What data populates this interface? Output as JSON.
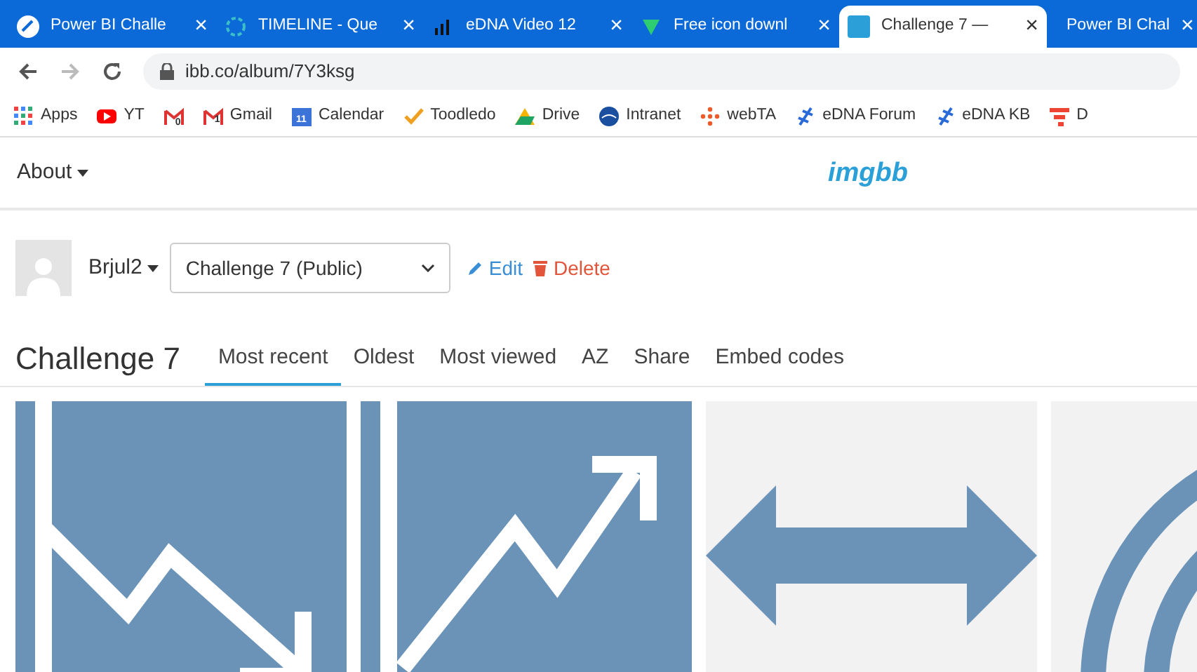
{
  "browser": {
    "tabs": [
      {
        "title": "Power BI Challe",
        "selected": false
      },
      {
        "title": "TIMELINE - Que",
        "selected": false
      },
      {
        "title": "eDNA Video 12",
        "selected": false
      },
      {
        "title": "Free icon downl",
        "selected": false
      },
      {
        "title": "Challenge 7 —",
        "selected": true
      },
      {
        "title": "Power BI Chal",
        "selected": false
      }
    ],
    "tab_close": "×",
    "address": "ibb.co/album/7Y3ksg",
    "bookmarks": [
      {
        "kind": "grid",
        "label": "Apps"
      },
      {
        "kind": "play",
        "label": "YT"
      },
      {
        "kind": "mail",
        "count": "0"
      },
      {
        "kind": "mail",
        "label": "Gmail",
        "count": "1"
      },
      {
        "kind": "calendar",
        "label": "Calendar",
        "count": "11"
      },
      {
        "kind": "check",
        "label": "Toodledo"
      },
      {
        "kind": "drive",
        "label": "Drive"
      },
      {
        "kind": "globe",
        "label": "Intranet"
      },
      {
        "kind": "dots",
        "label": "webTA"
      },
      {
        "kind": "helix",
        "label": "eDNA Forum"
      },
      {
        "kind": "helix",
        "label": "eDNA KB"
      },
      {
        "kind": "bars",
        "label": "D"
      }
    ]
  },
  "site": {
    "menu": "About",
    "logo": "imgbb"
  },
  "album_bar": {
    "user": "Brjul2",
    "album_select": "Challenge 7 (Public)",
    "edit": "Edit",
    "delete": "Delete"
  },
  "album": {
    "title": "Challenge 7",
    "tabs": [
      {
        "label": "Most recent",
        "selected": true
      },
      {
        "label": "Oldest",
        "selected": false
      },
      {
        "label": "Most viewed",
        "selected": false
      },
      {
        "label": "AZ",
        "selected": false
      },
      {
        "label": "Share",
        "selected": false
      },
      {
        "label": "Embed codes",
        "selected": false
      }
    ],
    "images": [
      {
        "kind": "down"
      },
      {
        "kind": "up"
      },
      {
        "kind": "double"
      },
      {
        "kind": "rings"
      }
    ]
  }
}
